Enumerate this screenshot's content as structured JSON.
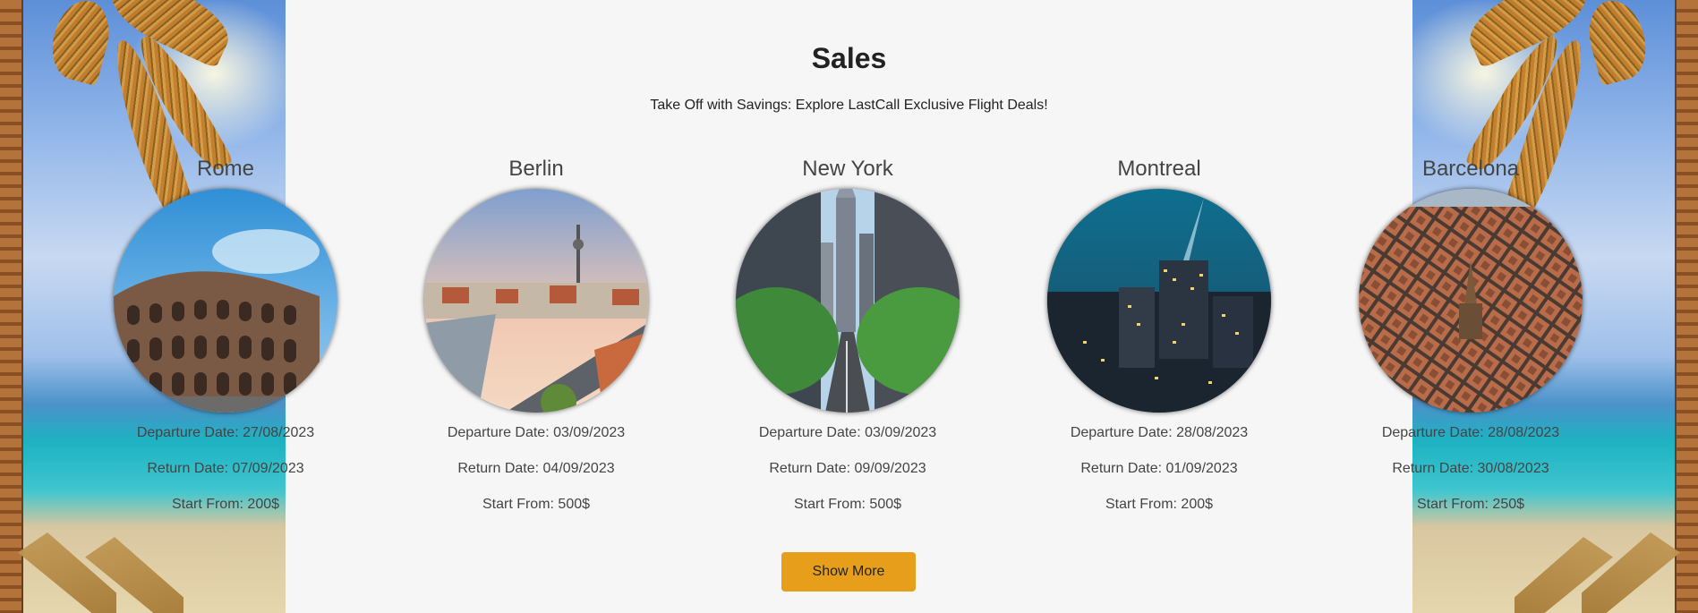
{
  "title": "Sales",
  "subtitle": "Take Off with Savings: Explore LastCall Exclusive Flight Deals!",
  "deals": [
    {
      "city": "Rome",
      "departure": "Departure Date: 27/08/2023",
      "return": "Return Date: 07/09/2023",
      "price": "Start From: 200$"
    },
    {
      "city": "Berlin",
      "departure": "Departure Date: 03/09/2023",
      "return": "Return Date: 04/09/2023",
      "price": "Start From: 500$"
    },
    {
      "city": "New York",
      "departure": "Departure Date: 03/09/2023",
      "return": "Return Date: 09/09/2023",
      "price": "Start From: 500$"
    },
    {
      "city": "Montreal",
      "departure": "Departure Date: 28/08/2023",
      "return": "Return Date: 01/09/2023",
      "price": "Start From: 200$"
    },
    {
      "city": "Barcelona",
      "departure": "Departure Date: 28/08/2023",
      "return": "Return Date: 30/08/2023",
      "price": "Start From: 250$"
    }
  ],
  "show_more_label": "Show More",
  "colors": {
    "button": "#e79e1b",
    "background": "#f6f6f6",
    "text": "#444444"
  }
}
